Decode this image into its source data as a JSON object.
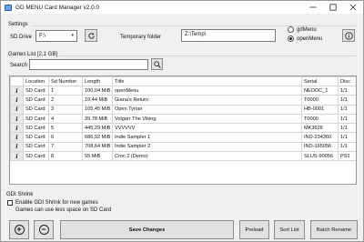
{
  "window": {
    "title": "GD MENU Card Manager v2.0.0"
  },
  "settings": {
    "group_label": "Settings",
    "sd_drive_label": "SD Drive",
    "sd_drive_value": "F:\\",
    "temp_folder_label": "Temporary folder",
    "temp_folder_value": "Z:\\Temp\\",
    "radio_options": [
      "gdMenu",
      "openMenu"
    ],
    "radio_selected": "openMenu"
  },
  "games": {
    "group_label": "Games List [2,1 GB]",
    "search_label": "Search",
    "search_value": "",
    "columns": [
      "",
      "Location",
      "Sd Number",
      "Length",
      "Title",
      "Serial",
      "Disc"
    ],
    "info_glyph": "i",
    "rows": [
      {
        "location": "SD Card",
        "sd_number": "1",
        "length": "100,04 MiB",
        "title": "openMenu",
        "serial": "NEODC_1",
        "disc": "1/1"
      },
      {
        "location": "SD Card",
        "sd_number": "2",
        "length": "10,44 MiB",
        "title": "Giana's Return",
        "serial": "T0000",
        "disc": "1/1"
      },
      {
        "location": "SD Card",
        "sd_number": "3",
        "length": "105,45 MiB",
        "title": "Open Tyrian",
        "serial": "HB-0001",
        "disc": "1/1"
      },
      {
        "location": "SD Card",
        "sd_number": "4",
        "length": "39,78 MiB",
        "title": "Volgarr The Viking",
        "serial": "T0000",
        "disc": "1/1"
      },
      {
        "location": "SD Card",
        "sd_number": "5",
        "length": "445,29 MiB",
        "title": "VVVVVV",
        "serial": "MK3626",
        "disc": "1/1"
      },
      {
        "location": "SD Card",
        "sd_number": "6",
        "length": "686,92 MiB",
        "title": "Indie Sampler 1",
        "serial": "IND-234360",
        "disc": "1/1"
      },
      {
        "location": "SD Card",
        "sd_number": "7",
        "length": "708,64 MiB",
        "title": "Indie Sampler 2",
        "serial": "IND-165056",
        "disc": "1/1"
      },
      {
        "location": "SD Card",
        "sd_number": "8",
        "length": "55 MiB",
        "title": "Croc 2 (Demo)",
        "serial": "SLUS-90056",
        "disc": "PS1"
      }
    ]
  },
  "shrink": {
    "group_label": "GDI Shrink",
    "enable_label": "Enable GDI Shrink for new games",
    "enable_checked": false,
    "note": "Games can use less space on SD Card"
  },
  "footer": {
    "add_glyph": "+",
    "remove_glyph": "−",
    "save_label": "Save Changes",
    "preload_label": "Preload",
    "sort_label": "Sort List",
    "batch_label": "Batch Rename"
  },
  "icons": {
    "refresh": "refresh-icon",
    "info": "info-icon",
    "search": "search-icon"
  }
}
